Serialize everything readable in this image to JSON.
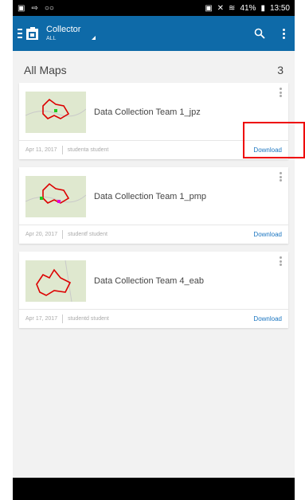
{
  "statusbar": {
    "left_icons": [
      "photo-icon",
      "cast-icon",
      "voicemail-icon"
    ],
    "battery": "41%",
    "time": "13:50"
  },
  "appbar": {
    "title": "Collector",
    "subtitle": "ALL"
  },
  "list": {
    "title": "All Maps",
    "count": "3",
    "items": [
      {
        "name": "Data Collection Team 1_jpz",
        "date": "Apr 11, 2017",
        "owner": "studenta student",
        "action": "Download"
      },
      {
        "name": "Data Collection Team 1_pmp",
        "date": "Apr 20, 2017",
        "owner": "studentf student",
        "action": "Download"
      },
      {
        "name": "Data Collection Team 4_eab",
        "date": "Apr 17, 2017",
        "owner": "studentd student",
        "action": "Download"
      }
    ]
  },
  "colors": {
    "appbar": "#0e6aa8",
    "link": "#1a75c0",
    "highlight": "#e00000"
  }
}
